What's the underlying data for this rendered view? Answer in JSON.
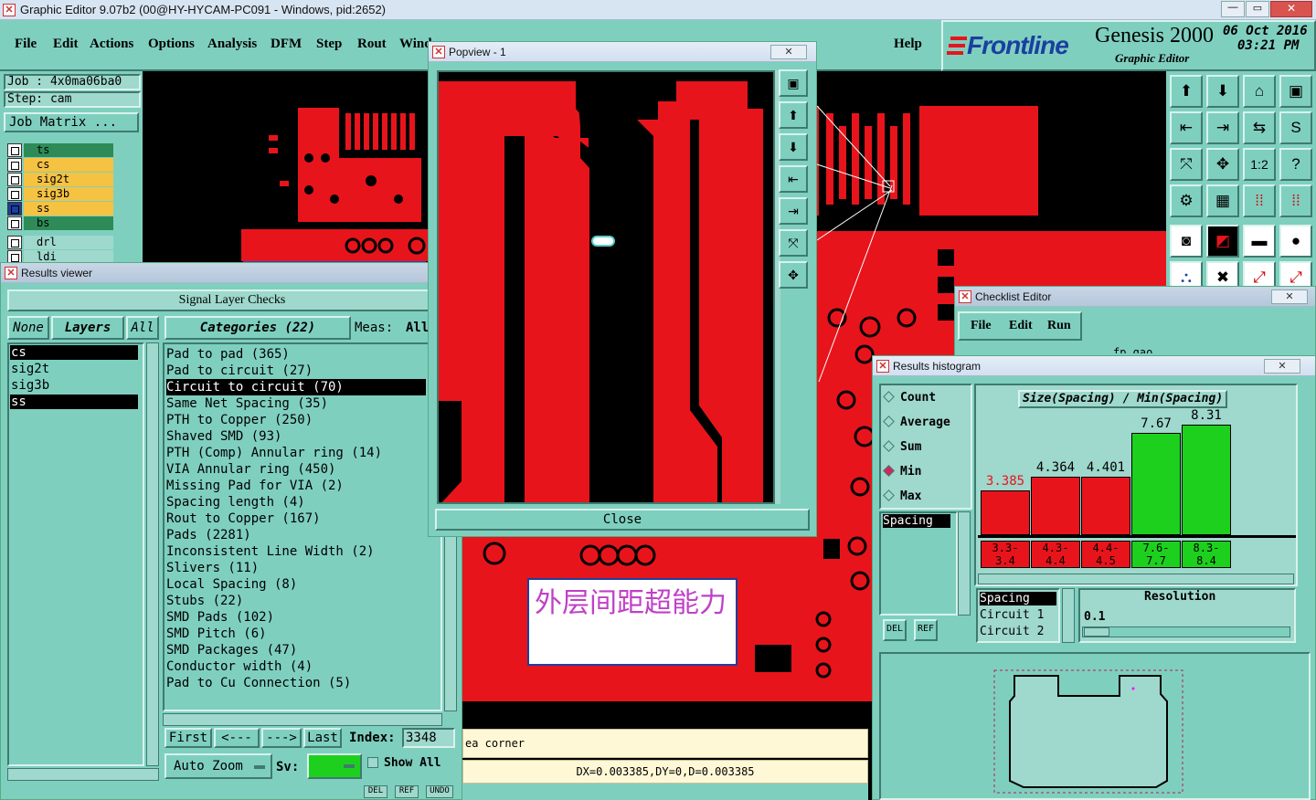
{
  "app": {
    "title": "Graphic Editor 9.07b2 (00@HY-HYCAM-PC091 - Windows, pid:2652)"
  },
  "menu": [
    "File",
    "Edit",
    "Actions",
    "Options",
    "Analysis",
    "DFM",
    "Step",
    "Rout",
    "Wind"
  ],
  "help": "Help",
  "brand": {
    "logo": "Frontline",
    "product": "Genesis 2000",
    "subtitle": "Graphic Editor",
    "date": "06 Oct 2016",
    "time": "03:21 PM"
  },
  "job": {
    "job_label": "Job : 4x0ma06ba0",
    "step_label": "Step: cam",
    "matrix_btn": "Job Matrix ..."
  },
  "layers": [
    {
      "name": "ts",
      "color": "#2e8b57"
    },
    {
      "name": "cs",
      "color": "#f5c242"
    },
    {
      "name": "sig2t",
      "color": "#f5c242"
    },
    {
      "name": "sig3b",
      "color": "#f5c242"
    },
    {
      "name": "ss",
      "color": "#f5c242"
    },
    {
      "name": "bs",
      "color": "#2e8b57"
    },
    {
      "name": "drl",
      "color": "#9fd8cc"
    },
    {
      "name": "ldi",
      "color": "#9fd8cc"
    }
  ],
  "results_viewer": {
    "title": "Results viewer",
    "header": "Signal Layer Checks",
    "none": "None",
    "layers": "Layers",
    "all": "All",
    "categories_label": "Categories (22)",
    "meas_label": "Meas:",
    "meas_value": "All",
    "layer_list": [
      "cs",
      "sig2t",
      "sig3b",
      "ss"
    ],
    "categories": [
      "Pad to pad (365)",
      "Pad to circuit (27)",
      "Circuit to circuit (70)",
      "Same Net Spacing (35)",
      "PTH to Copper (250)",
      "Shaved SMD (93)",
      "PTH (Comp) Annular ring (14)",
      "VIA Annular ring (450)",
      "Missing Pad for VIA (2)",
      "Spacing length (4)",
      "Rout to Copper (167)",
      "Pads (2281)",
      "Inconsistent Line Width (2)",
      "Slivers (11)",
      "Local Spacing (8)",
      "Stubs (22)",
      "SMD Pads (102)",
      "SMD Pitch (6)",
      "SMD Packages (47)",
      "Conductor width (4)",
      "Pad to Cu Connection (5)"
    ],
    "nav": {
      "first": "First",
      "prev": "<---",
      "next": "--->",
      "last": "Last",
      "index_label": "Index:",
      "index_value": "3348"
    },
    "auto_zoom": "Auto Zoom",
    "sv_label": "Sv:",
    "show_all": "Show All",
    "del": "DEL",
    "ref": "REF",
    "undo": "UNDO"
  },
  "popview": {
    "title": "Popview - 1",
    "close": "Close"
  },
  "annotation": "外层间距超能力",
  "status": {
    "message": "ea corner",
    "measure": "DX=0.003385,DY=0,D=0.003385"
  },
  "checklist": {
    "title": "Checklist Editor",
    "menu": [
      "File",
      "Edit",
      "Run"
    ],
    "cut_text": "fp gao"
  },
  "histogram": {
    "title": "Results histogram",
    "options": [
      "Count",
      "Average",
      "Sum",
      "Min",
      "Max"
    ],
    "selected_option": "Min",
    "left_list": [
      "Spacing"
    ],
    "del": "DEL",
    "ref": "REF",
    "chart_title": "Size(Spacing) / Min(Spacing)",
    "type_list": [
      "Spacing",
      "Circuit 1",
      "Circuit 2"
    ],
    "resolution_label": "Resolution",
    "resolution_value": "0.1"
  },
  "chart_data": {
    "type": "bar",
    "title": "Size(Spacing) / Min(Spacing)",
    "categories": [
      "3.3-3.4",
      "4.3-4.4",
      "4.4-4.5",
      "7.6-7.7",
      "8.3-8.4"
    ],
    "values": [
      3.385,
      4.364,
      4.401,
      7.67,
      8.31
    ],
    "value_labels": [
      "3.385",
      "4.364",
      "4.401",
      "7.67",
      "8.31"
    ],
    "bin_lines": [
      [
        "3.3-",
        "3.4"
      ],
      [
        "4.3-",
        "4.4"
      ],
      [
        "4.4-",
        "4.5"
      ],
      [
        "7.6-",
        "7.7"
      ],
      [
        "8.3-",
        "8.4"
      ]
    ],
    "colors": [
      "#e8141b",
      "#e8141b",
      "#e8141b",
      "#1ed01e",
      "#1ed01e"
    ],
    "ylim": [
      0,
      8.9
    ]
  },
  "colors": {
    "teal": "#7fcfbf",
    "copper": "#ff0000",
    "board": "#000000",
    "yellow": "#fff8d6"
  }
}
